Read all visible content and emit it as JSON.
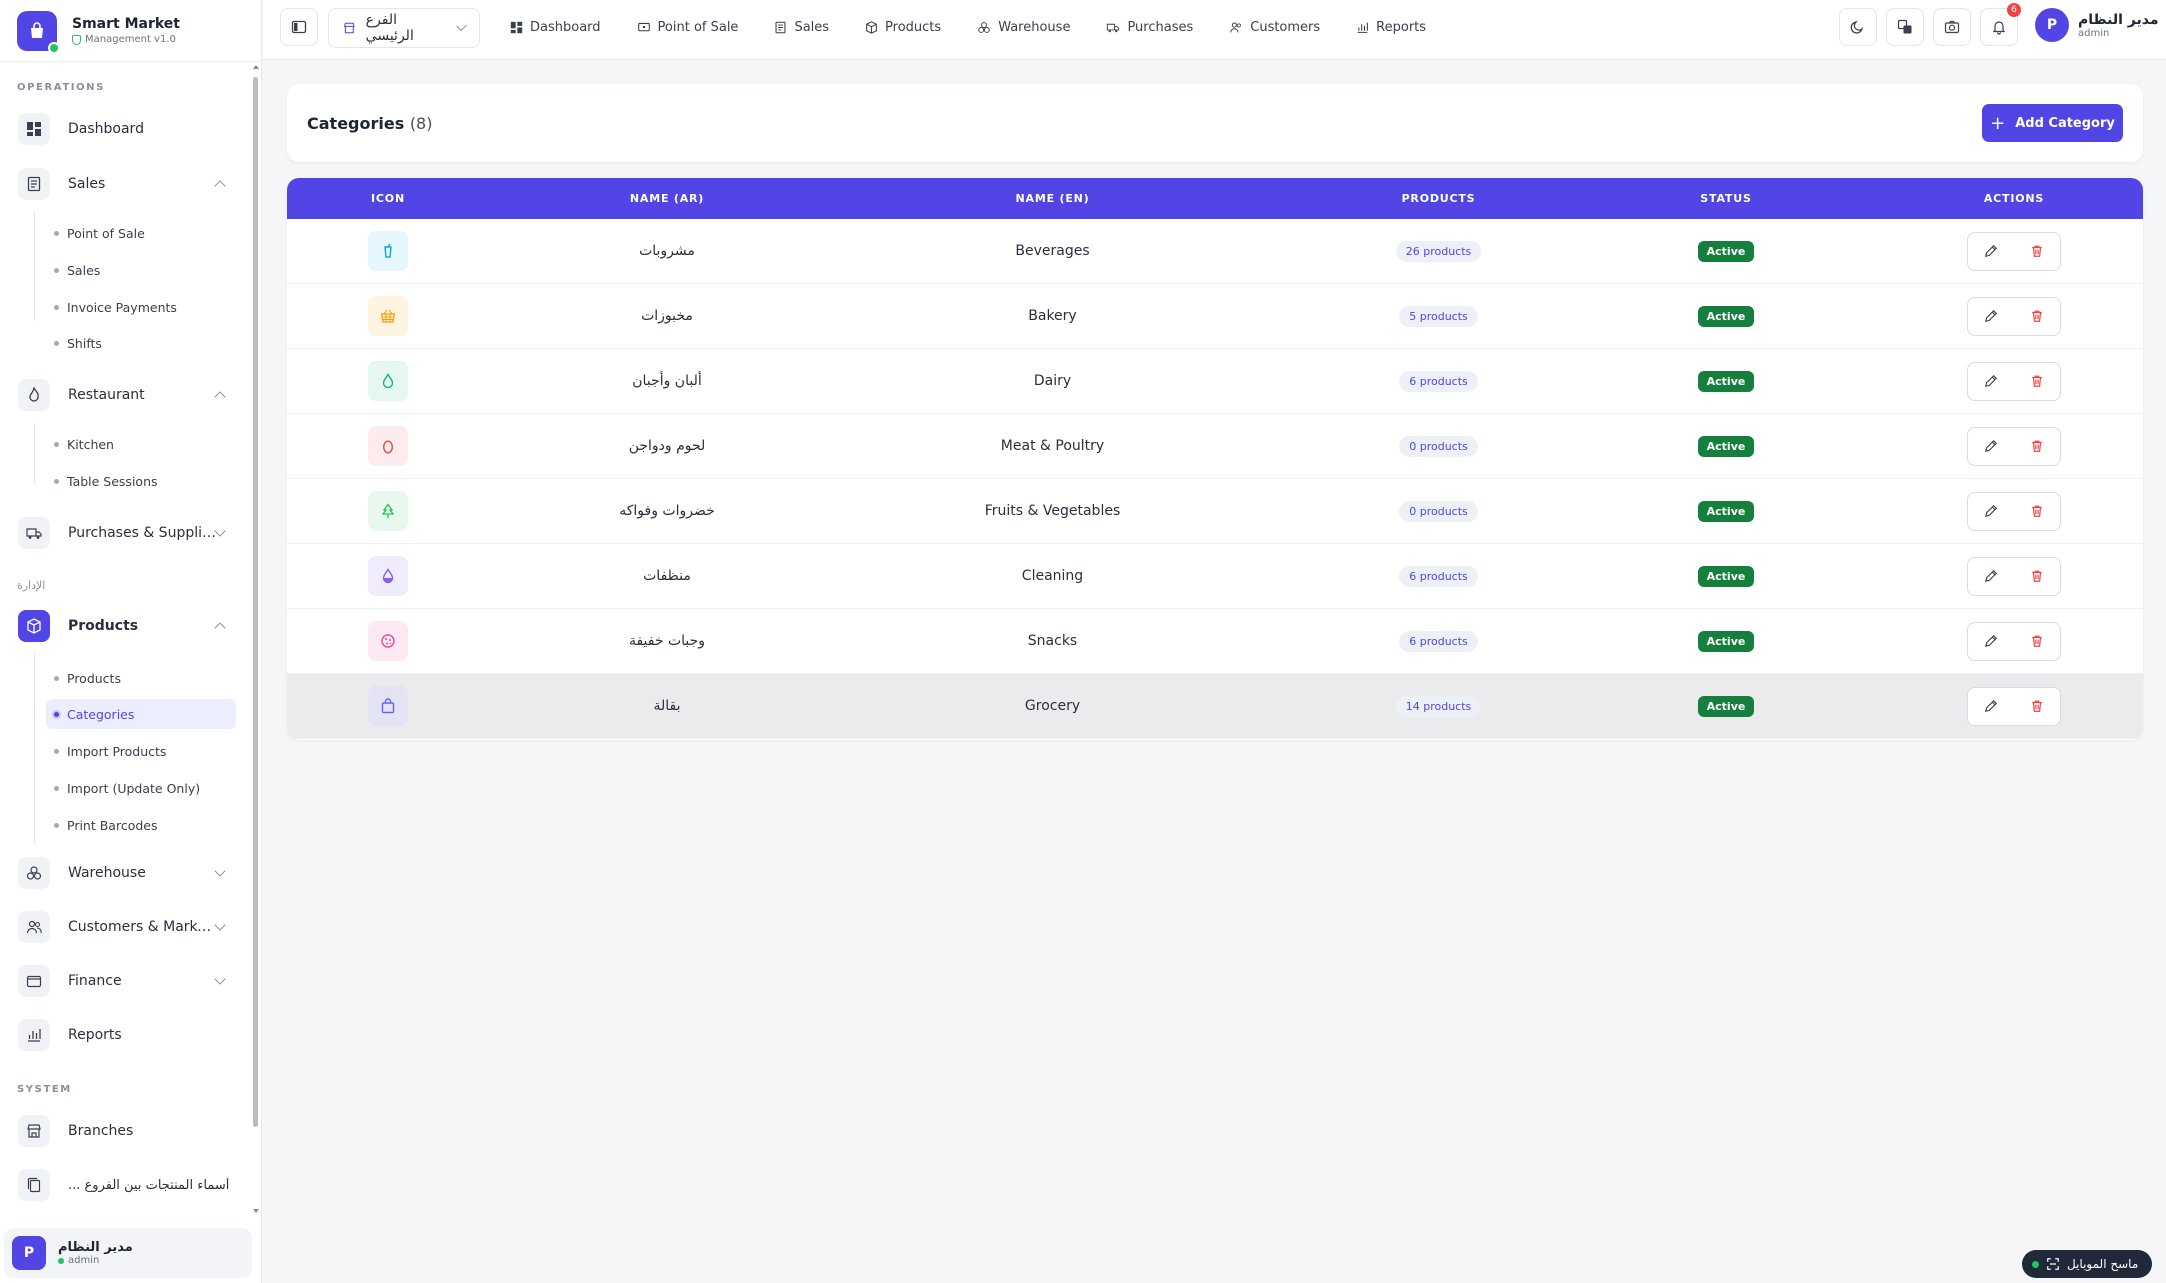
{
  "brand": {
    "name": "Smart Market",
    "version": "Management v1.0"
  },
  "sidebar": {
    "sections": {
      "operations": "OPERATIONS",
      "admin_ar": "الإدارة",
      "system": "SYSTEM"
    },
    "items": {
      "dashboard": "Dashboard",
      "sales": "Sales",
      "restaurant": "Restaurant",
      "purchases": "Purchases & Suppliers",
      "products": "Products",
      "warehouse": "Warehouse",
      "customers": "Customers & Marketi...",
      "finance": "Finance",
      "reports": "Reports",
      "branches": "Branches",
      "branch_products": "... أسماء المنتجات بين الفروع"
    },
    "sales_sub": [
      "Point of Sale",
      "Sales",
      "Invoice Payments",
      "Shifts"
    ],
    "restaurant_sub": [
      "Kitchen",
      "Table Sessions"
    ],
    "products_sub": [
      "Products",
      "Categories",
      "Import Products",
      "Import (Update Only)",
      "Print Barcodes"
    ],
    "user": {
      "name": "مدير النظام",
      "role": "admin",
      "initial": "P"
    }
  },
  "topbar": {
    "branch": "الفرع الرئيسي",
    "nav": [
      "Dashboard",
      "Point of Sale",
      "Sales",
      "Products",
      "Warehouse",
      "Purchases",
      "Customers",
      "Reports"
    ],
    "notifications": "6",
    "user": {
      "name": "مدير النظام",
      "role": "admin",
      "initial": "P"
    }
  },
  "page": {
    "title": "Categories",
    "count": "(8)",
    "add_button": "Add Category"
  },
  "table": {
    "columns": [
      "ICON",
      "NAME (AR)",
      "NAME (EN)",
      "PRODUCTS",
      "STATUS",
      "ACTIONS"
    ],
    "rows": [
      {
        "icon": "cup-icon",
        "name_ar": "مشروبات",
        "name_en": "Beverages",
        "products": "26 products",
        "status": "Active",
        "color": "#0ea5e9",
        "bg": "#e6f6fd"
      },
      {
        "icon": "basket-icon",
        "name_ar": "مخبوزات",
        "name_en": "Bakery",
        "products": "5 products",
        "status": "Active",
        "color": "#f59e0b",
        "bg": "#fff4e0"
      },
      {
        "icon": "drop-icon",
        "name_ar": "ألبان وأجبان",
        "name_en": "Dairy",
        "products": "6 products",
        "status": "Active",
        "color": "#10b981",
        "bg": "#e6f7f1"
      },
      {
        "icon": "egg-icon",
        "name_ar": "لحوم ودواجن",
        "name_en": "Meat & Poultry",
        "products": "0 products",
        "status": "Active",
        "color": "#ef4444",
        "bg": "#fdeced"
      },
      {
        "icon": "tree-icon",
        "name_ar": "خضروات وفواكه",
        "name_en": "Fruits & Vegetables",
        "products": "0 products",
        "status": "Active",
        "color": "#22c55e",
        "bg": "#e8f8ee"
      },
      {
        "icon": "droplet-half-icon",
        "name_ar": "منظفات",
        "name_en": "Cleaning",
        "products": "6 products",
        "status": "Active",
        "color": "#8b5cf6",
        "bg": "#f1ecfd"
      },
      {
        "icon": "cookie-icon",
        "name_ar": "وجبات خفيفة",
        "name_en": "Snacks",
        "products": "6 products",
        "status": "Active",
        "color": "#ec4899",
        "bg": "#fde9f3"
      },
      {
        "icon": "bag-icon",
        "name_ar": "بقالة",
        "name_en": "Grocery",
        "products": "14 products",
        "status": "Active",
        "color": "#6366f1",
        "bg": "#e3e3f3"
      }
    ]
  },
  "mobile_scanner": "ماسح الموبايل",
  "colors": {
    "accent": "#5146e5",
    "active": "#15803d",
    "danger": "#ef4444"
  }
}
